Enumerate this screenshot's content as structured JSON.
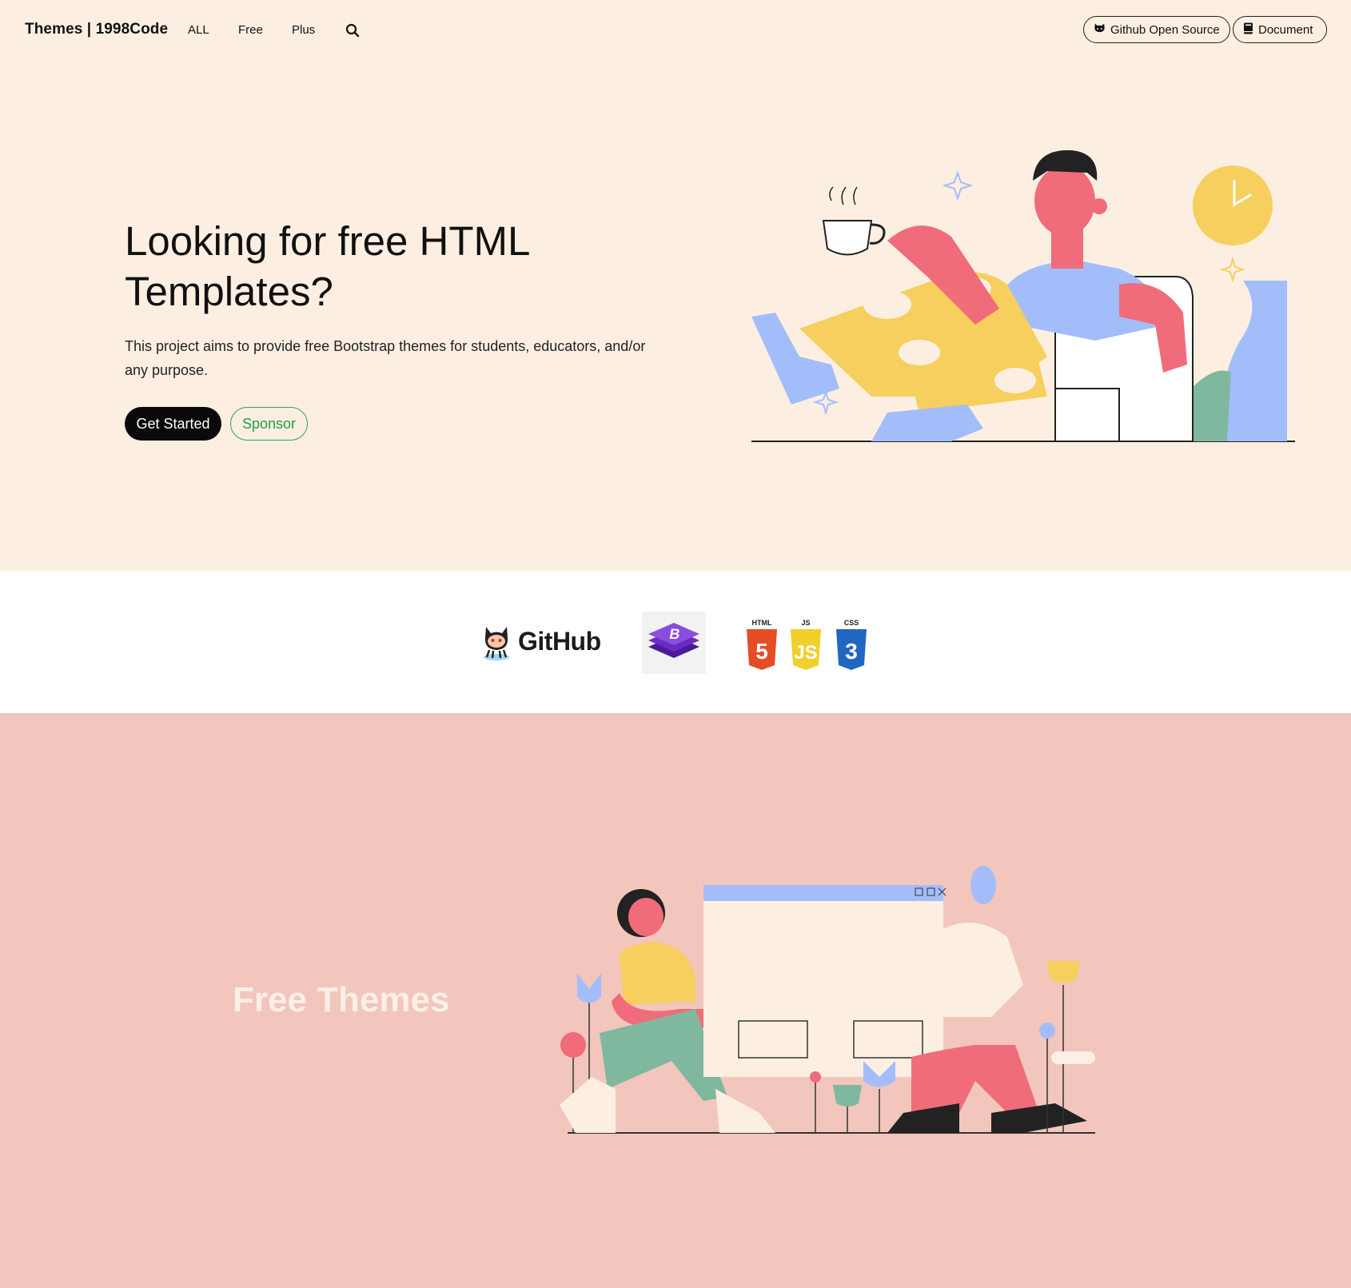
{
  "nav": {
    "brand": "Themes | 1998Code",
    "links": [
      "ALL",
      "Free",
      "Plus"
    ],
    "github_button": "Github Open Source",
    "document_button": "Document"
  },
  "hero": {
    "title": "Looking for free HTML Templates?",
    "text": "This project aims to provide free Bootstrap themes for students, educators, and/or any purpose.",
    "primary_button": "Get Started",
    "secondary_button": "Sponsor"
  },
  "logos": {
    "github": "GitHub",
    "html": "HTML",
    "js": "JS",
    "css": "CSS"
  },
  "themes": {
    "title": "Free Themes"
  },
  "colors": {
    "hero_bg": "#fcefe2",
    "logos_bg": "#ffffff",
    "themes_bg": "#f2c6bc",
    "sponsor_green": "#1f9e41",
    "illus_yellow": "#f6cf5f",
    "illus_pink": "#f06c7a",
    "illus_blue": "#a3bdfb",
    "illus_green": "#7fb79f"
  }
}
